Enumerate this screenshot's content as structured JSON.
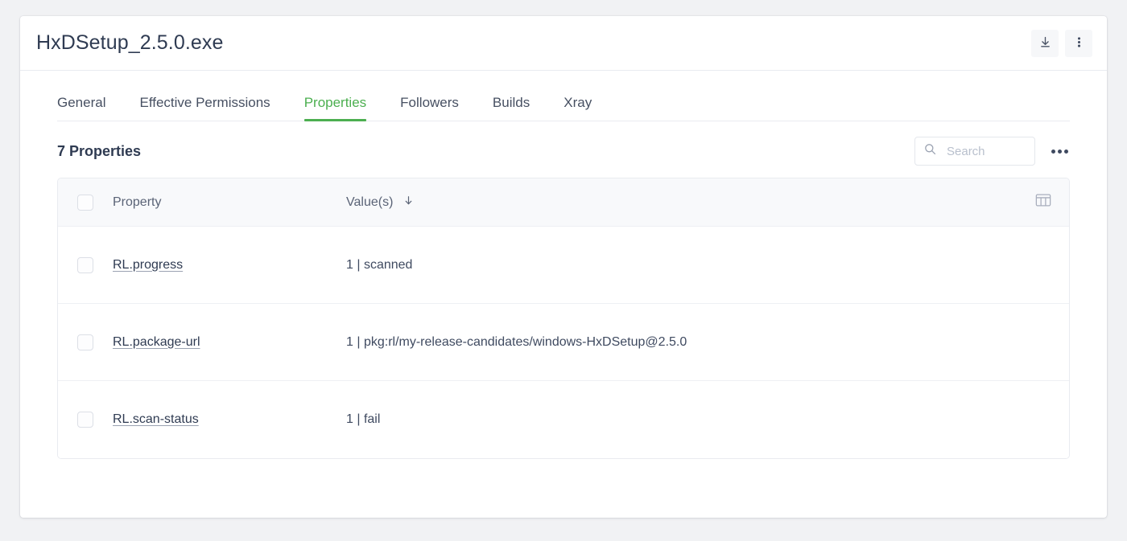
{
  "header": {
    "title": "HxDSetup_2.5.0.exe",
    "download_icon": "download-icon",
    "more_icon": "more-vertical-icon"
  },
  "tabs": [
    {
      "label": "General",
      "active": false
    },
    {
      "label": "Effective Permissions",
      "active": false
    },
    {
      "label": "Properties",
      "active": true
    },
    {
      "label": "Followers",
      "active": false
    },
    {
      "label": "Builds",
      "active": false
    },
    {
      "label": "Xray",
      "active": false
    }
  ],
  "toolbar": {
    "count_title": "7 Properties",
    "search_placeholder": "Search",
    "search_value": "",
    "search_icon": "search-icon",
    "more_icon": "more-horizontal-icon"
  },
  "table": {
    "columns": {
      "property": "Property",
      "values": "Value(s)",
      "sort_arrow": "↓",
      "columns_icon": "table-columns-icon"
    },
    "rows": [
      {
        "property": "RL.progress",
        "value": "1 | scanned"
      },
      {
        "property": "RL.package-url",
        "value": "1 | pkg:rl/my-release-candidates/windows-HxDSetup@2.5.0"
      },
      {
        "property": "RL.scan-status",
        "value": "1 | fail"
      }
    ]
  },
  "colors": {
    "accent_green": "#4caf50",
    "text_primary": "#2f3b52",
    "text_secondary": "#5a6376",
    "border": "#e9ebf0",
    "header_bg": "#f8f9fb",
    "page_bg": "#f1f2f4"
  }
}
